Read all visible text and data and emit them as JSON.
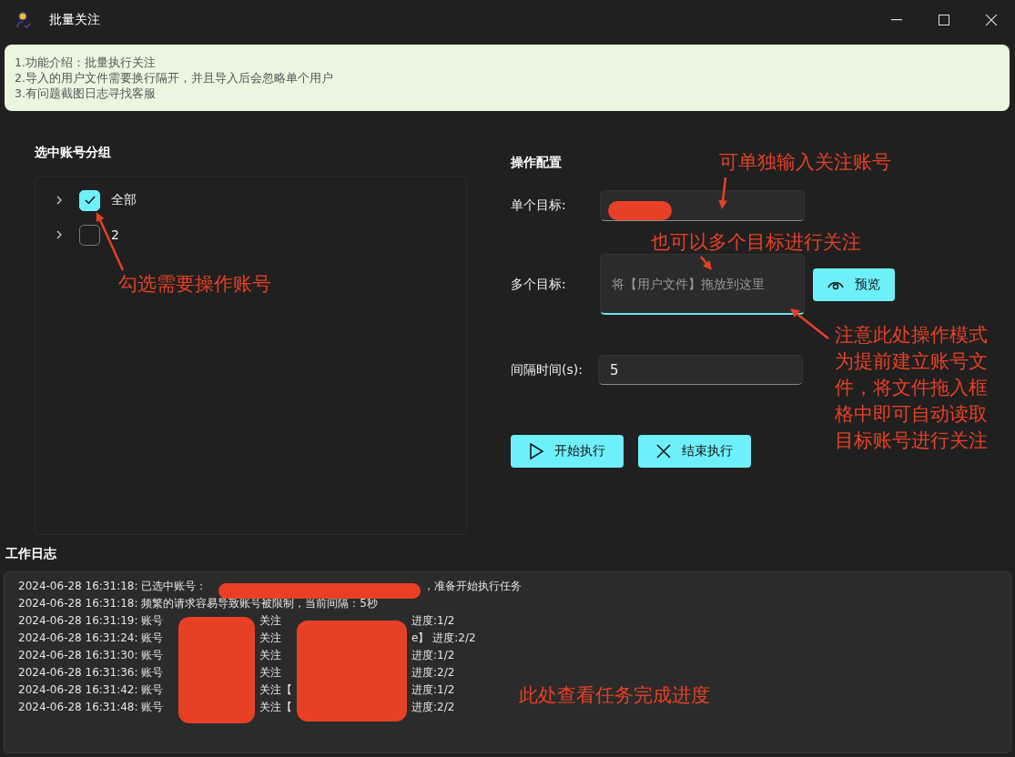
{
  "window": {
    "title": "批量关注"
  },
  "notice": {
    "lines": [
      "1.功能介绍：批量执行关注",
      "2.导入的用户文件需要换行隔开，并且导入后会忽略单个用户",
      "3.有问题截图日志寻找客服"
    ]
  },
  "account_groups": {
    "title": "选中账号分组",
    "items": [
      {
        "label": "全部",
        "checked": true,
        "expanded": false
      },
      {
        "label": "2",
        "checked": false,
        "expanded": false
      }
    ]
  },
  "config": {
    "title": "操作配置",
    "single_target": {
      "label": "单个目标:"
    },
    "multi_target": {
      "label": "多个目标:",
      "placeholder": "将【用户文件】拖放到这里",
      "preview_button": "预览"
    },
    "interval": {
      "label": "间隔时间(s):",
      "value": "5"
    },
    "buttons": [
      {
        "kind": "start",
        "label": "开始执行"
      },
      {
        "kind": "stop",
        "label": "结束执行"
      }
    ]
  },
  "work_log": {
    "title": "工作日志",
    "lines": [
      {
        "kind": "selected",
        "segments": [
          "2024-06-28 16:31:18: 已选中账号：",
          "，准备开始执行任务"
        ]
      },
      {
        "kind": "plain",
        "segments": [
          "2024-06-28 16:31:18: 频繁的请求容易导致账号被限制，当前间隔：5秒"
        ]
      },
      {
        "kind": "progress",
        "segments": [
          "2024-06-28 16:31:19: 账号",
          "关注",
          "进度:1/2"
        ]
      },
      {
        "kind": "progress",
        "segments": [
          "2024-06-28 16:31:24: 账号",
          "关注",
          "e】 进度:2/2"
        ]
      },
      {
        "kind": "progress",
        "segments": [
          "2024-06-28 16:31:30: 账号",
          "关注",
          "进度:1/2"
        ]
      },
      {
        "kind": "progress",
        "segments": [
          "2024-06-28 16:31:36: 账号",
          "关注",
          "进度:2/2"
        ]
      },
      {
        "kind": "progress",
        "segments": [
          "2024-06-28 16:31:42: 账号",
          "关注【",
          "进度:1/2"
        ]
      },
      {
        "kind": "progress",
        "segments": [
          "2024-06-28 16:31:48: 账号",
          "关注【",
          "进度:2/2"
        ]
      }
    ]
  },
  "annotations": [
    {
      "text": "可单独输入关注账号"
    },
    {
      "text": "也可以多个目标进行关注"
    },
    {
      "text": "勾选需要操作账号"
    },
    {
      "text": "注意此处操作模式为提前建立账号文件，将文件拖入框格中即可自动读取目标账号进行关注"
    },
    {
      "text": "此处查看任务完成进度"
    }
  ]
}
